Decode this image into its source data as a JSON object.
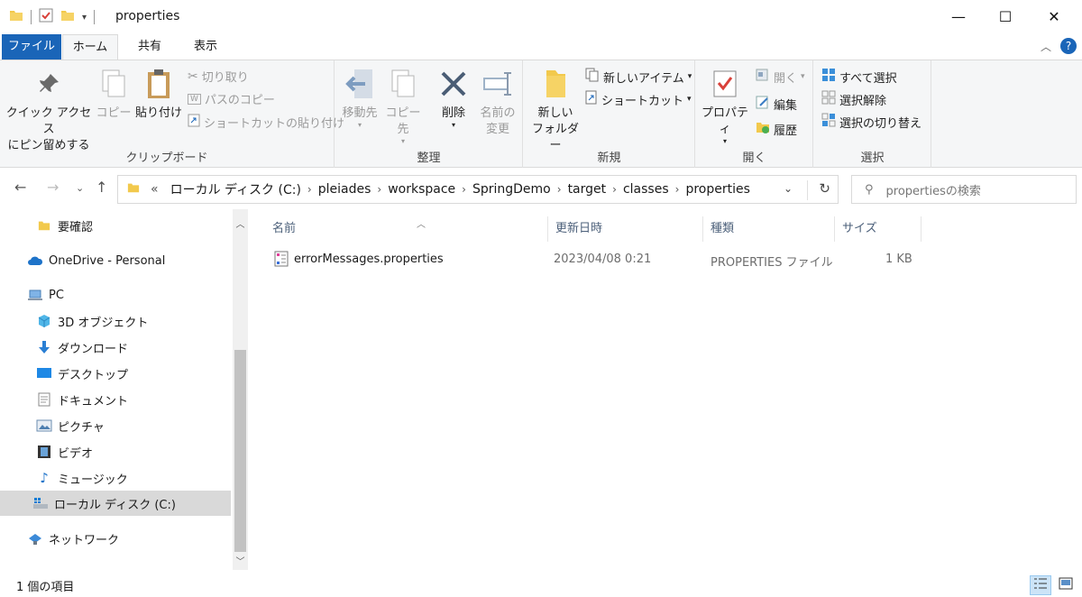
{
  "window": {
    "title": "properties",
    "minimize": "—",
    "maximize": "☐",
    "close": "✕"
  },
  "ribbon_tabs": {
    "file": "ファイル",
    "home": "ホーム",
    "share": "共有",
    "view": "表示"
  },
  "ribbon": {
    "clipboard": {
      "label": "クリップボード",
      "pin_line1": "クイック アクセス",
      "pin_line2": "にピン留めする",
      "copy": "コピー",
      "paste": "貼り付け",
      "cut": "切り取り",
      "copy_path": "パスのコピー",
      "paste_shortcut": "ショートカットの貼り付け"
    },
    "organize": {
      "label": "整理",
      "move_to": "移動先",
      "copy_to": "コピー先",
      "delete": "削除",
      "rename_line1": "名前の",
      "rename_line2": "変更"
    },
    "new": {
      "label": "新規",
      "new_folder_line1": "新しい",
      "new_folder_line2": "フォルダー",
      "new_item": "新しいアイテム",
      "shortcut": "ショートカット"
    },
    "open": {
      "label": "開く",
      "properties": "プロパティ",
      "open": "開く",
      "edit": "編集",
      "history": "履歴"
    },
    "select": {
      "label": "選択",
      "select_all": "すべて選択",
      "select_none": "選択解除",
      "invert": "選択の切り替え"
    }
  },
  "address": {
    "crumbs": [
      "ローカル ディスク (C:)",
      "pleiades",
      "workspace",
      "SpringDemo",
      "target",
      "classes",
      "properties"
    ],
    "overflow": "«",
    "search_placeholder": "propertiesの検索"
  },
  "navpane": {
    "items": [
      {
        "label": "要確認",
        "icon": "folder-icon"
      },
      {
        "label": "OneDrive - Personal",
        "icon": "cloud-icon"
      },
      {
        "label": "PC",
        "icon": "pc-icon"
      },
      {
        "label": "3D オブジェクト",
        "icon": "cube-icon"
      },
      {
        "label": "ダウンロード",
        "icon": "download-icon"
      },
      {
        "label": "デスクトップ",
        "icon": "desktop-icon"
      },
      {
        "label": "ドキュメント",
        "icon": "document-icon"
      },
      {
        "label": "ピクチャ",
        "icon": "picture-icon"
      },
      {
        "label": "ビデオ",
        "icon": "video-icon"
      },
      {
        "label": "ミュージック",
        "icon": "music-icon"
      },
      {
        "label": "ローカル ディスク (C:)",
        "icon": "drive-icon"
      },
      {
        "label": "ネットワーク",
        "icon": "network-icon"
      }
    ]
  },
  "list": {
    "columns": {
      "name": "名前",
      "date": "更新日時",
      "type": "種類",
      "size": "サイズ"
    },
    "rows": [
      {
        "name": "errorMessages.properties",
        "date": "2023/04/08 0:21",
        "type": "PROPERTIES ファイル",
        "size": "1 KB"
      }
    ]
  },
  "status": {
    "count": "1 個の項目"
  },
  "colors": {
    "accent": "#1a65b8",
    "selection": "#d9d9d9"
  }
}
